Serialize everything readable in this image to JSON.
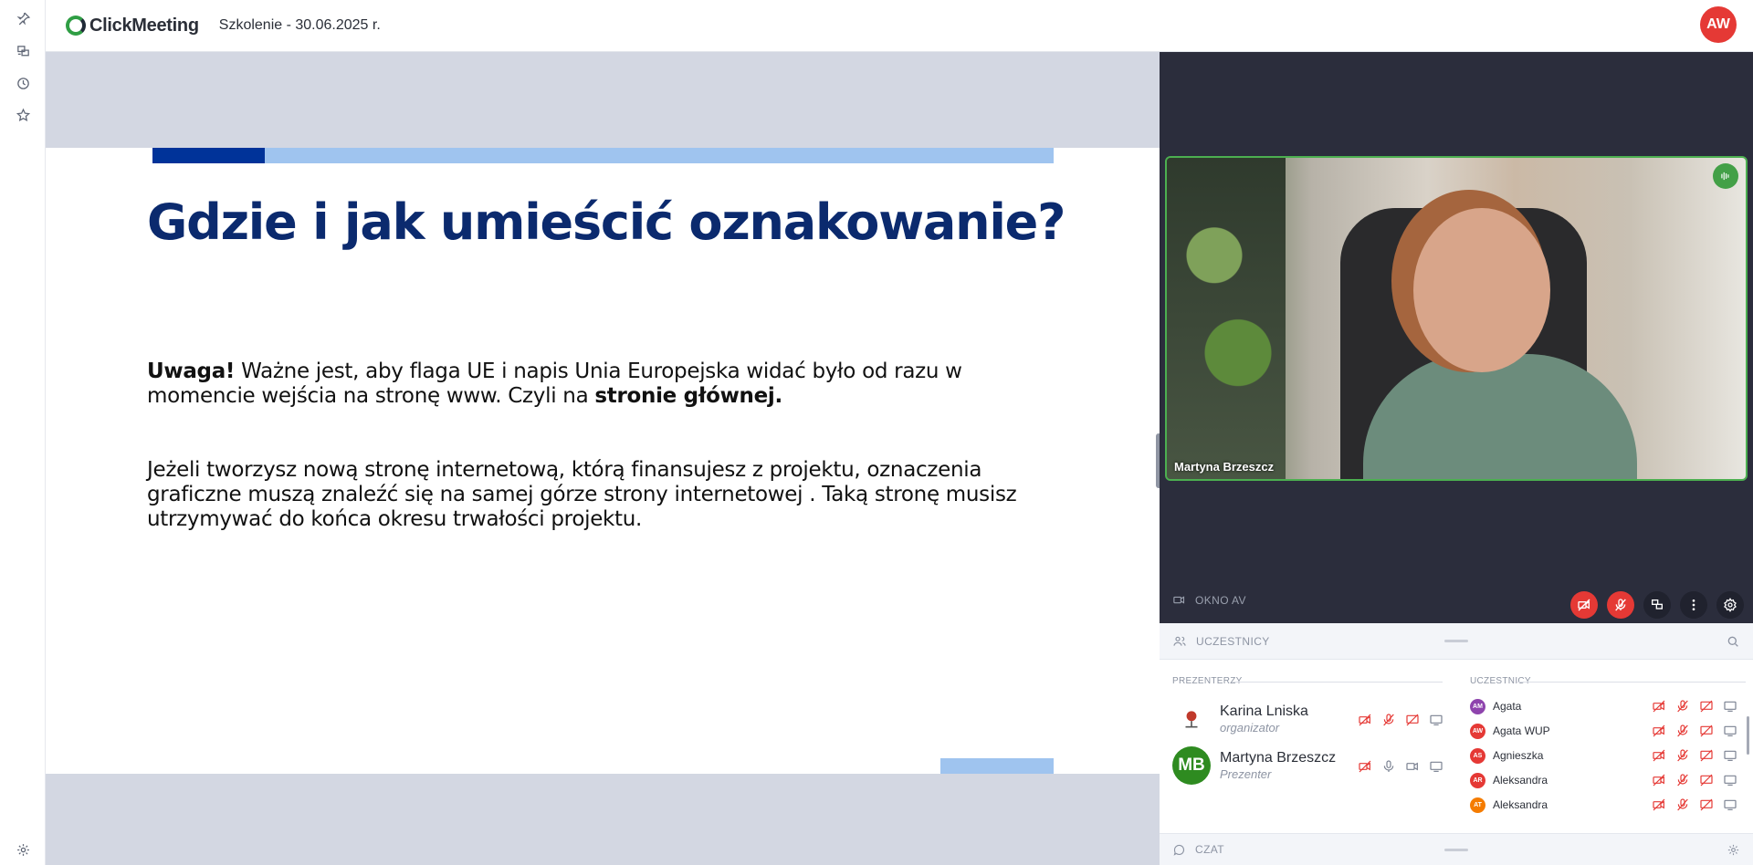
{
  "header": {
    "logo_text": "ClickMeeting",
    "meeting_title": "Szkolenie - 30.06.2025 r.",
    "user_initials": "AW"
  },
  "rail": {
    "icons": [
      "pin-icon",
      "layers-icon",
      "clock-icon",
      "star-icon",
      "gear-icon"
    ]
  },
  "slide": {
    "title": "Gdzie i jak umieścić oznakowanie?",
    "p1_bold": "Uwaga!",
    "p1_text": " Ważne jest, aby flaga UE i napis Unia Europejska widać było od razu w momencie wejścia na stronę www. Czyli na ",
    "p1_bold2": "stronie głównej.",
    "p2_text": "Jeżeli tworzysz nową stronę internetową, którą finansujesz z projektu, oznaczenia graficzne muszą znaleźć się na samej górze strony internetowej . Taką stronę musisz utrzymywać do końca okresu trwałości projektu.",
    "colors": {
      "title": "#0b2a6e",
      "bar_dark": "#003399",
      "bar_light": "#9fc4ef"
    }
  },
  "av": {
    "speaker_name": "Martyna Brzeszcz",
    "label": "OKNO AV"
  },
  "participants": {
    "header": "UCZESTNICY",
    "presenters_label": "PREZENTERZY",
    "attendees_label": "UCZESTNICY",
    "presenters": [
      {
        "initials": "",
        "name": "Karina Lniska",
        "role": "organizator",
        "color": "#ffffff"
      },
      {
        "initials": "MB",
        "name": "Martyna Brzeszcz",
        "role": "Prezenter",
        "color": "#2e8b20"
      }
    ],
    "attendees": [
      {
        "initials": "AM",
        "name": "Agata",
        "color": "#8e44ad"
      },
      {
        "initials": "AW",
        "name": "Agata WUP",
        "color": "#e53935"
      },
      {
        "initials": "AS",
        "name": "Agnieszka",
        "color": "#e53935"
      },
      {
        "initials": "AR",
        "name": "Aleksandra",
        "color": "#e53935"
      },
      {
        "initials": "AT",
        "name": "Aleksandra",
        "color": "#f57c00"
      }
    ]
  },
  "chat": {
    "label": "CZAT"
  }
}
